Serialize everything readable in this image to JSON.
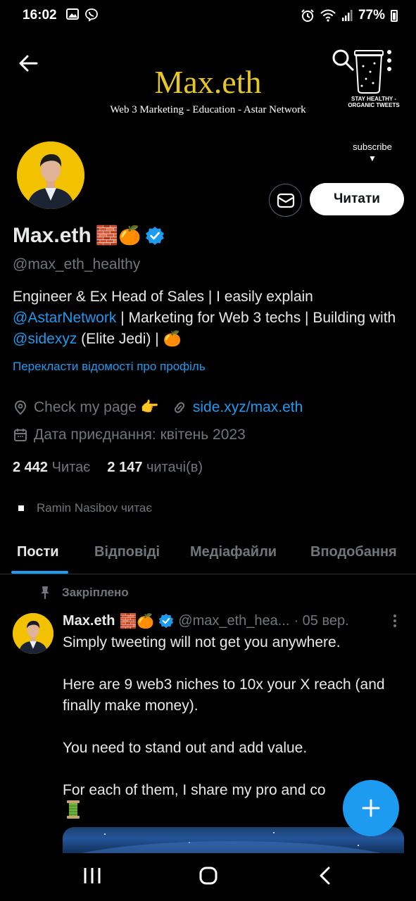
{
  "status_bar": {
    "time": "16:02",
    "battery": "77%",
    "icons": [
      "gallery-icon",
      "viber-icon",
      "alarm-icon",
      "wifi-icon",
      "signal-icon",
      "battery-icon"
    ]
  },
  "banner": {
    "title": "Max.eth",
    "subtitle": "Web 3 Marketing - Education - Astar Network",
    "badge_text": "STAY HEALTHY - ORGANIC TWEETS",
    "subscribe": "subscribe",
    "title_color": "#e7c628"
  },
  "profile": {
    "name": "Max.eth",
    "name_emojis": "🧱🍊",
    "handle": "@max_eth_healthy",
    "bio_1": "Engineer & Ex Head of Sales | I easily explain ",
    "bio_link_1": "@AstarNetwork",
    "bio_2": " | Marketing for Web 3 techs | Building with ",
    "bio_link_2": "@sidexyz",
    "bio_3": " (Elite Jedi) | 🍊",
    "translate": "Перекласти відомості про профіль",
    "location": "Check my page 👉",
    "website": "side.xyz/max.eth",
    "joined": "Дата приєднання: квітень 2023",
    "following_count": "2 442",
    "following_label": "Читає",
    "followers_count": "2 147",
    "followers_label": "читачі(в)",
    "followed_by": "Ramin Nasibov читає",
    "follow_button": "Читати",
    "accent_color": "#1d9bf0"
  },
  "tabs": [
    {
      "label": "Пости",
      "active": true
    },
    {
      "label": "Відповіді",
      "active": false
    },
    {
      "label": "Медіафайли",
      "active": false
    },
    {
      "label": "Вподобання",
      "active": false
    }
  ],
  "pinned_tweet": {
    "pinned_label": "Закріплено",
    "author_name": "Max.eth",
    "author_emojis": "🧱🍊",
    "author_handle": "@max_eth_hea...",
    "date": "· 05 вер.",
    "text": "Simply tweeting will not get you anywhere.\n\nHere are 9 web3 niches to 10x your X reach (and finally make money).\n\nYou need to stand out and add value.\n\nFor each of them, I share my pro and co"
  }
}
